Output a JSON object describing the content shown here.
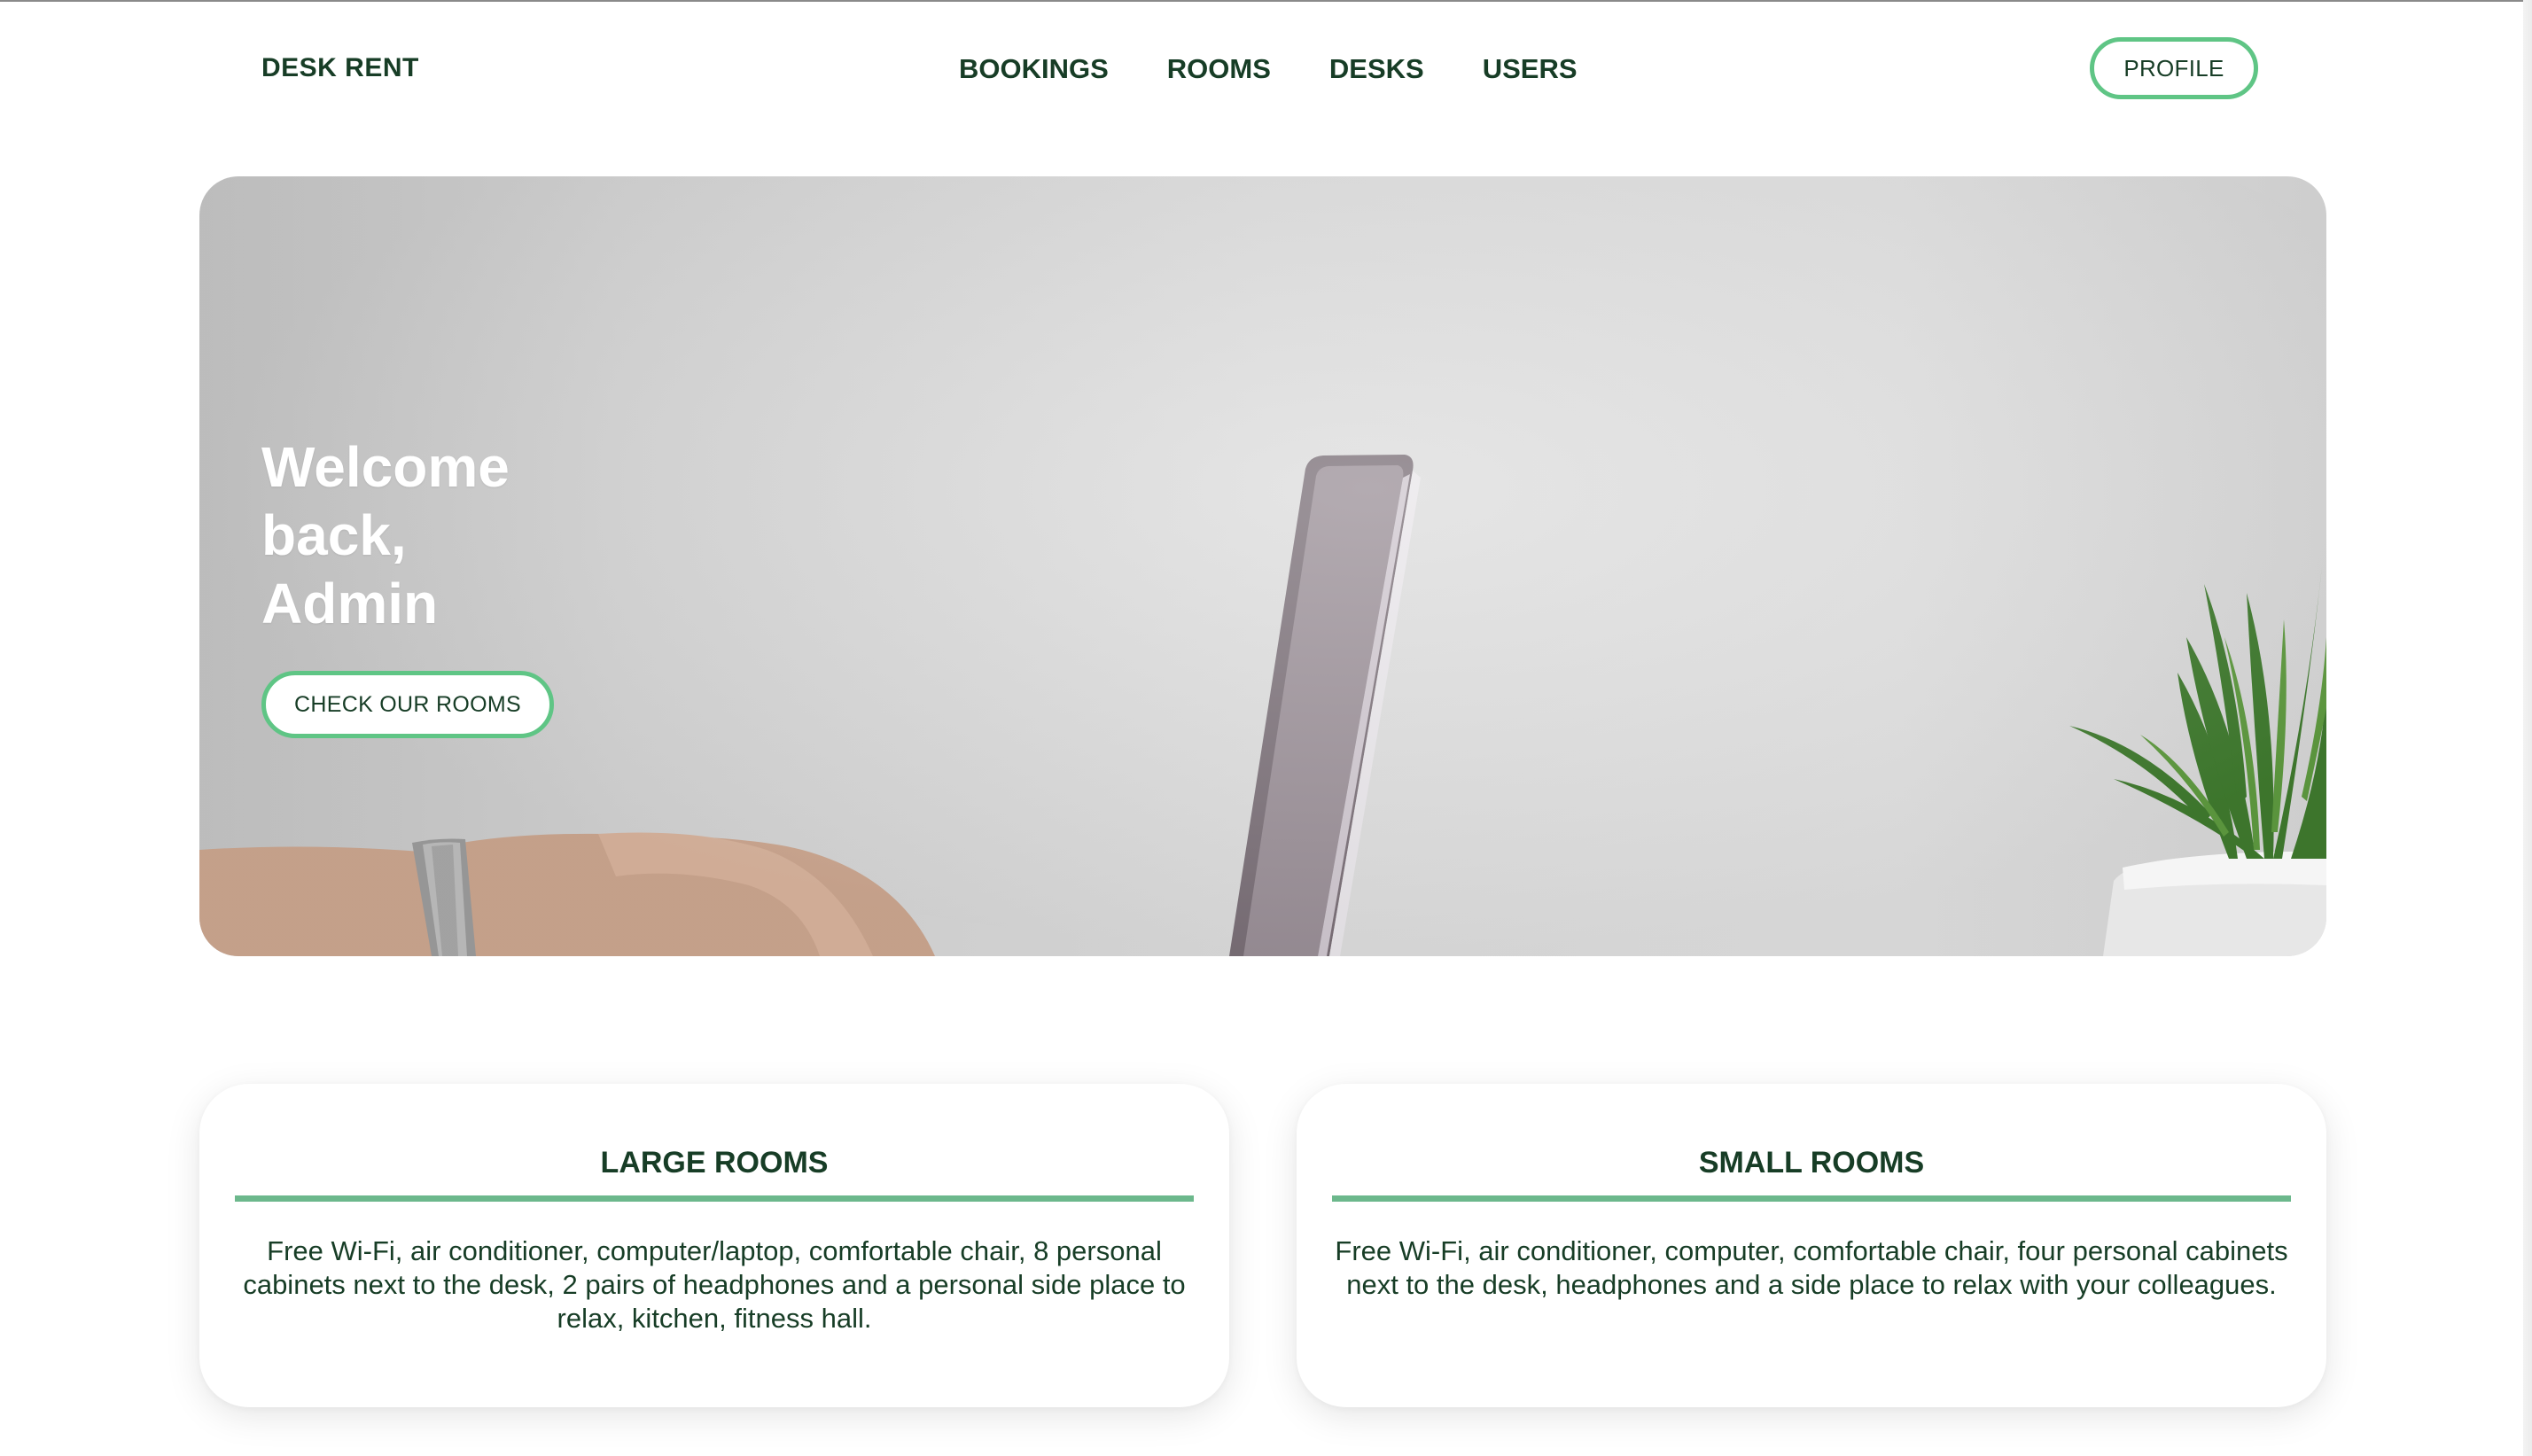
{
  "app": {
    "logo": "DESK RENT"
  },
  "nav": {
    "items": [
      {
        "label": "BOOKINGS"
      },
      {
        "label": "ROOMS"
      },
      {
        "label": "DESKS"
      },
      {
        "label": "USERS"
      }
    ],
    "profile_label": "PROFILE"
  },
  "hero": {
    "title_lines": [
      "Welcome",
      "back,",
      "Admin"
    ],
    "cta_label": "CHECK OUR ROOMS"
  },
  "cards": [
    {
      "title": "LARGE ROOMS",
      "description": "Free Wi-Fi, air conditioner, computer/laptop, comfortable chair, 8 personal cabinets next to the desk, 2 pairs of headphones and a personal side place to relax, kitchen, fitness hall."
    },
    {
      "title": "SMALL ROOMS",
      "description": "Free Wi-Fi, air conditioner, computer, comfortable chair, four personal cabinets next to the desk, headphones and a side place to relax with your colleagues."
    }
  ],
  "colors": {
    "accent": "#5fc585",
    "text": "#173d26",
    "rule": "#6cb88c"
  }
}
